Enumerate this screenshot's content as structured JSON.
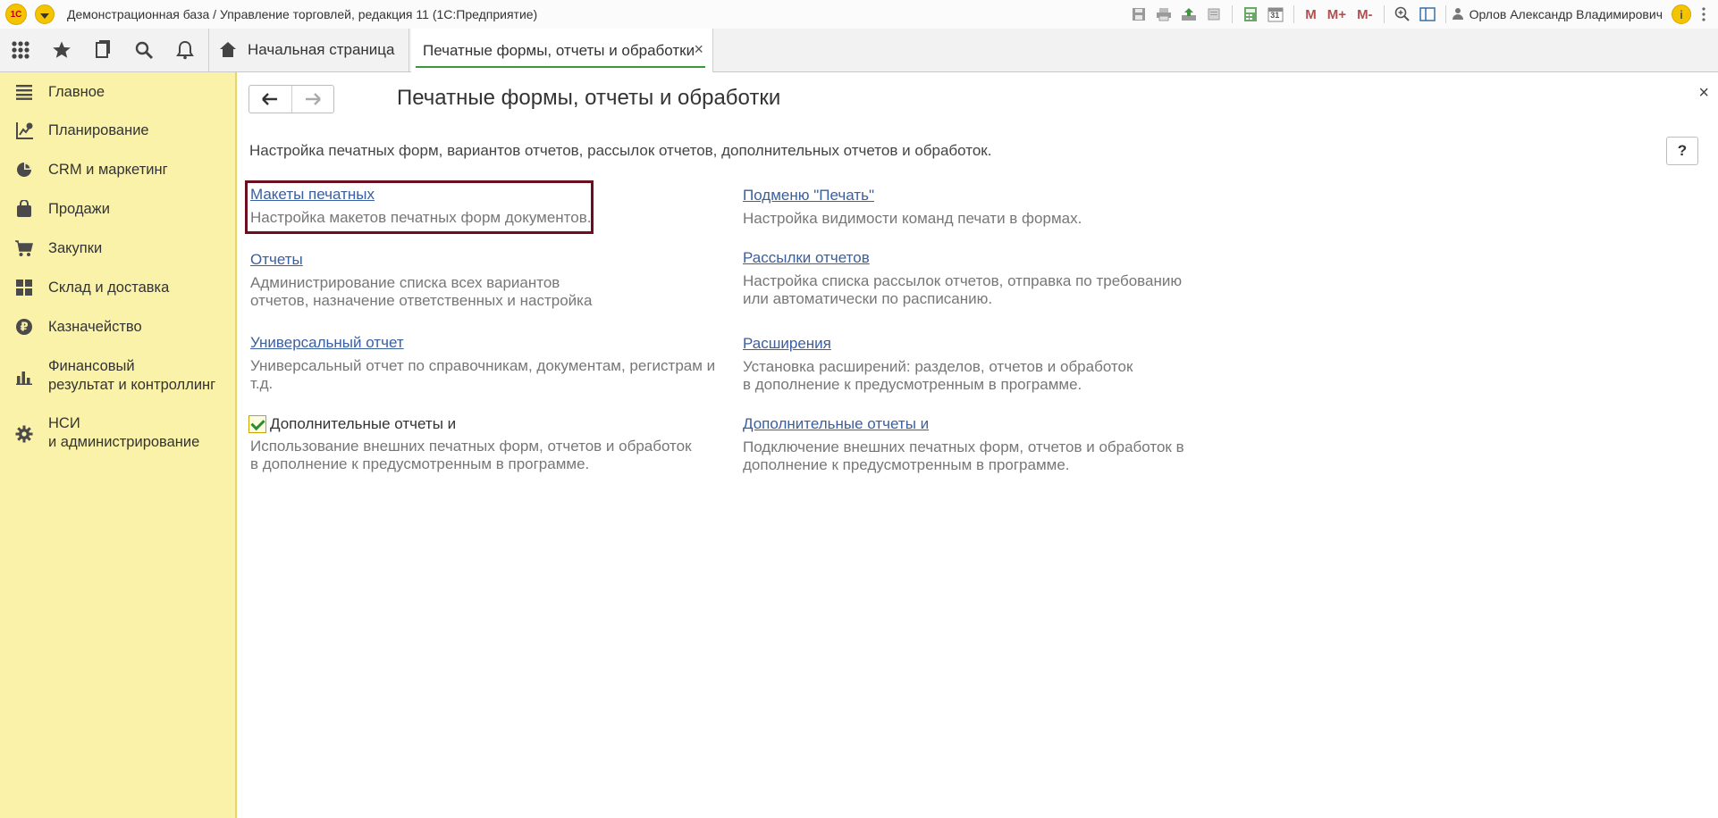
{
  "titlebar": {
    "logo": "1С",
    "title": "Демонстрационная база / Управление торговлей, редакция 11   (1С:Предприятие)",
    "icons": [
      "save-icon",
      "print-icon",
      "upload-icon",
      "preview-icon",
      "calculator-icon",
      "calendar-icon"
    ],
    "calendar_day": "31",
    "memory_buttons": [
      "M",
      "M+",
      "M-"
    ],
    "user": "Орлов Александр Владимирович",
    "info": "i"
  },
  "tabs": {
    "home": "Начальная страница",
    "active": "Печатные формы, отчеты и обработки",
    "close": "×"
  },
  "sidebar": {
    "items": [
      {
        "label": "Главное",
        "icon": "menu-lines-icon"
      },
      {
        "label": "Планирование",
        "icon": "planning-icon"
      },
      {
        "label": "CRM и маркетинг",
        "icon": "pie-chart-icon"
      },
      {
        "label": "Продажи",
        "icon": "bag-icon"
      },
      {
        "label": "Закупки",
        "icon": "cart-icon"
      },
      {
        "label": "Склад и доставка",
        "icon": "warehouse-icon"
      },
      {
        "label": "Казначейство",
        "icon": "ruble-icon"
      },
      {
        "label": "Финансовый\nрезультат и контроллинг",
        "icon": "bar-chart-icon"
      },
      {
        "label": "НСИ\nи администрирование",
        "icon": "gear-icon"
      }
    ]
  },
  "content": {
    "title": "Печатные формы, отчеты и обработки",
    "description": "Настройка печатных форм, вариантов отчетов, рассылок отчетов, дополнительных отчетов и обработок.",
    "help": "?",
    "close": "×",
    "left": [
      {
        "link": "Макеты печатных ",
        "text": "Настройка макетов печатных форм документов."
      },
      {
        "link": "Отчеты",
        "text": "Администрирование списка всех вариантов\nотчетов, назначение ответственных и настройка"
      },
      {
        "link": "Универсальный отчет",
        "text": "Универсальный отчет по справочникам, документам, регистрам и\nт.д."
      },
      {
        "checkbox_label": "Дополнительные отчеты и",
        "checked": true,
        "text": "Использование внешних печатных форм, отчетов и обработок\nв дополнение к предусмотренным в программе."
      }
    ],
    "right": [
      {
        "link": "Подменю \"Печать\"",
        "text": "Настройка видимости команд печати в формах."
      },
      {
        "link": "Рассылки отчетов",
        "text": "Настройка списка рассылок отчетов, отправка по требованию\nили автоматически по расписанию."
      },
      {
        "link": "Расширения",
        "text": "Установка расширений: разделов, отчетов и обработок\nв дополнение к предусмотренным в программе."
      },
      {
        "link": "Дополнительные отчеты и ",
        "text": "Подключение внешних печатных форм, отчетов и обработок в\nдополнение к предусмотренным в программе."
      }
    ]
  },
  "colors": {
    "sidebar_bg": "#fbf2a9",
    "link": "#3a5fa0",
    "highlight_border": "#6b0f1f",
    "tab_underline": "#3a9a3a"
  }
}
